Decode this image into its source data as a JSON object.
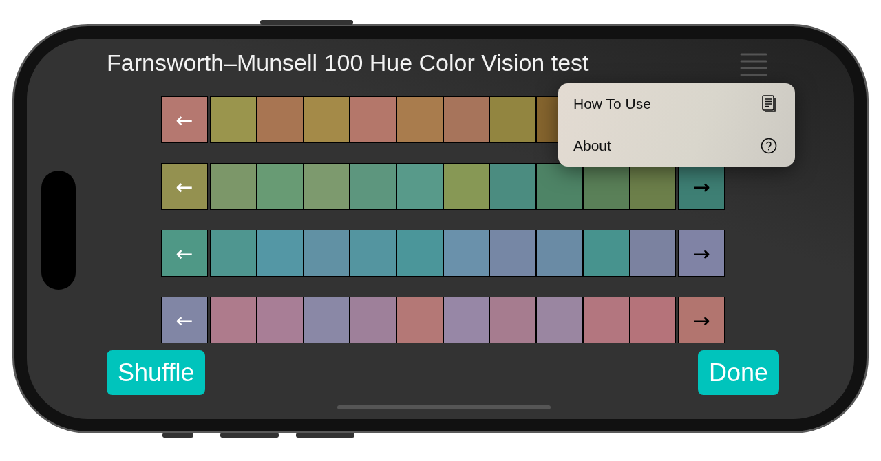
{
  "title": "Farnsworth–Munsell 100 Hue Color Vision test",
  "menu": {
    "items": [
      {
        "label": "How To Use",
        "kind": "document"
      },
      {
        "label": "About",
        "kind": "help"
      }
    ]
  },
  "rows": [
    {
      "left_arrow": {
        "label": "←",
        "color": "#b57870"
      },
      "tiles": [
        {
          "color": "#9a954d"
        },
        {
          "color": "#a87552"
        },
        {
          "color": "#a48a48"
        },
        {
          "color": "#b4776a"
        },
        {
          "color": "#a97c4d"
        },
        {
          "color": "#a7745b"
        },
        {
          "color": "#928540"
        },
        {
          "color": "#86652e"
        }
      ]
    },
    {
      "left_arrow": {
        "label": "←",
        "color": "#949150"
      },
      "tiles": [
        {
          "color": "#7c9769"
        },
        {
          "color": "#689b74"
        },
        {
          "color": "#7d9a6e"
        },
        {
          "color": "#5d967e"
        },
        {
          "color": "#589a8a"
        },
        {
          "color": "#879855"
        },
        {
          "color": "#4b8c80"
        },
        {
          "color": "#4e8466"
        },
        {
          "color": "#5a8058"
        },
        {
          "color": "#6c7f4a"
        }
      ],
      "right_arrow": {
        "label": "→",
        "color": "#3e7f74"
      }
    },
    {
      "left_arrow": {
        "label": "←",
        "color": "#4f9886"
      },
      "tiles": [
        {
          "color": "#4f9690"
        },
        {
          "color": "#5497a5"
        },
        {
          "color": "#6191a4"
        },
        {
          "color": "#5495a0"
        },
        {
          "color": "#4b969a"
        },
        {
          "color": "#6a91ab"
        },
        {
          "color": "#7687a5"
        },
        {
          "color": "#6a8ba5"
        },
        {
          "color": "#47938e"
        },
        {
          "color": "#7b82a0"
        }
      ],
      "right_arrow": {
        "label": "→",
        "color": "#8083a5"
      }
    },
    {
      "left_arrow": {
        "label": "←",
        "color": "#8186a5"
      },
      "tiles": [
        {
          "color": "#ae7b8c"
        },
        {
          "color": "#a87e96"
        },
        {
          "color": "#8a88a6"
        },
        {
          "color": "#9e809a"
        },
        {
          "color": "#b47876"
        },
        {
          "color": "#9787a6"
        },
        {
          "color": "#a67c8f"
        },
        {
          "color": "#9a86a1"
        },
        {
          "color": "#b3767f"
        },
        {
          "color": "#b5737a"
        }
      ],
      "right_arrow": {
        "label": "→",
        "color": "#b2756f"
      }
    }
  ],
  "buttons": [
    {
      "label": "Shuffle"
    },
    {
      "label": "Done"
    }
  ]
}
